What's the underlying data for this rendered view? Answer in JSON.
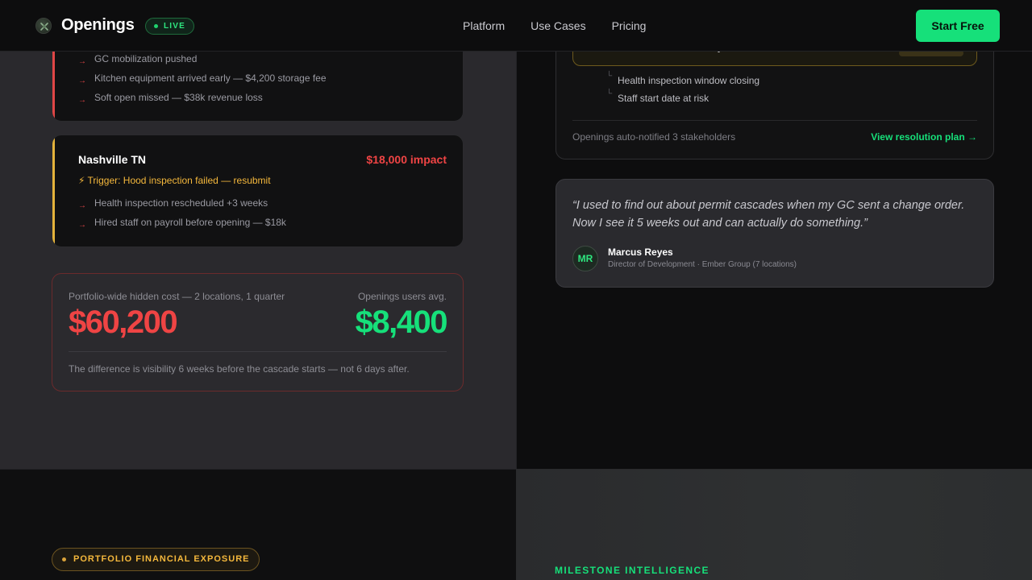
{
  "nav": {
    "brand": "Openings",
    "live_badge": "LIVE",
    "links": [
      "Platform",
      "Use Cases",
      "Pricing"
    ],
    "cta": "Start Free"
  },
  "locations": [
    {
      "title": "",
      "impact": "",
      "trigger": "",
      "accent_color": "#e04646",
      "bullets": [
        "GC mobilization pushed",
        "Kitchen equipment arrived early — $4,200 storage fee",
        "Soft open missed — $38k revenue loss"
      ]
    },
    {
      "title": "Nashville TN",
      "impact": "$18,000 impact",
      "trigger": "⚡ Trigger: Hood inspection failed — resubmit",
      "accent_color": "#e4b33b",
      "bullets": [
        "Health inspection rescheduled +3 weeks",
        "Hired staff on payroll before opening — $18k"
      ]
    }
  ],
  "cost_comparison": {
    "left_label": "Portfolio-wide hidden cost — 2 locations, 1 quarter",
    "left_value": "$60,200",
    "right_label": "Openings users avg.",
    "right_value": "$8,400",
    "note": "The difference is visibility 6 weeks before the cascade starts — not 6 days after."
  },
  "alert_panel": {
    "sub_items": [
      "Health inspection window closing",
      "Staff start date at risk"
    ],
    "footer_left": "Openings auto-notified 3 stakeholders",
    "footer_right": "View resolution plan →"
  },
  "testimonial": {
    "quote": "“I used to find out about permit cascades when my GC sent a change order. Now I see it 5 weeks out and can actually do something.”",
    "initials": "MR",
    "name": "Marcus Reyes",
    "role": "Director of Development · Ember Group (7 locations)"
  },
  "sections": {
    "financial_badge": "PORTFOLIO FINANCIAL EXPOSURE",
    "milestone_kicker": "MILESTONE INTELLIGENCE"
  },
  "colors": {
    "accent_green": "#16e07a",
    "danger_red": "#ef4444",
    "warning_amber": "#f5b83c"
  }
}
